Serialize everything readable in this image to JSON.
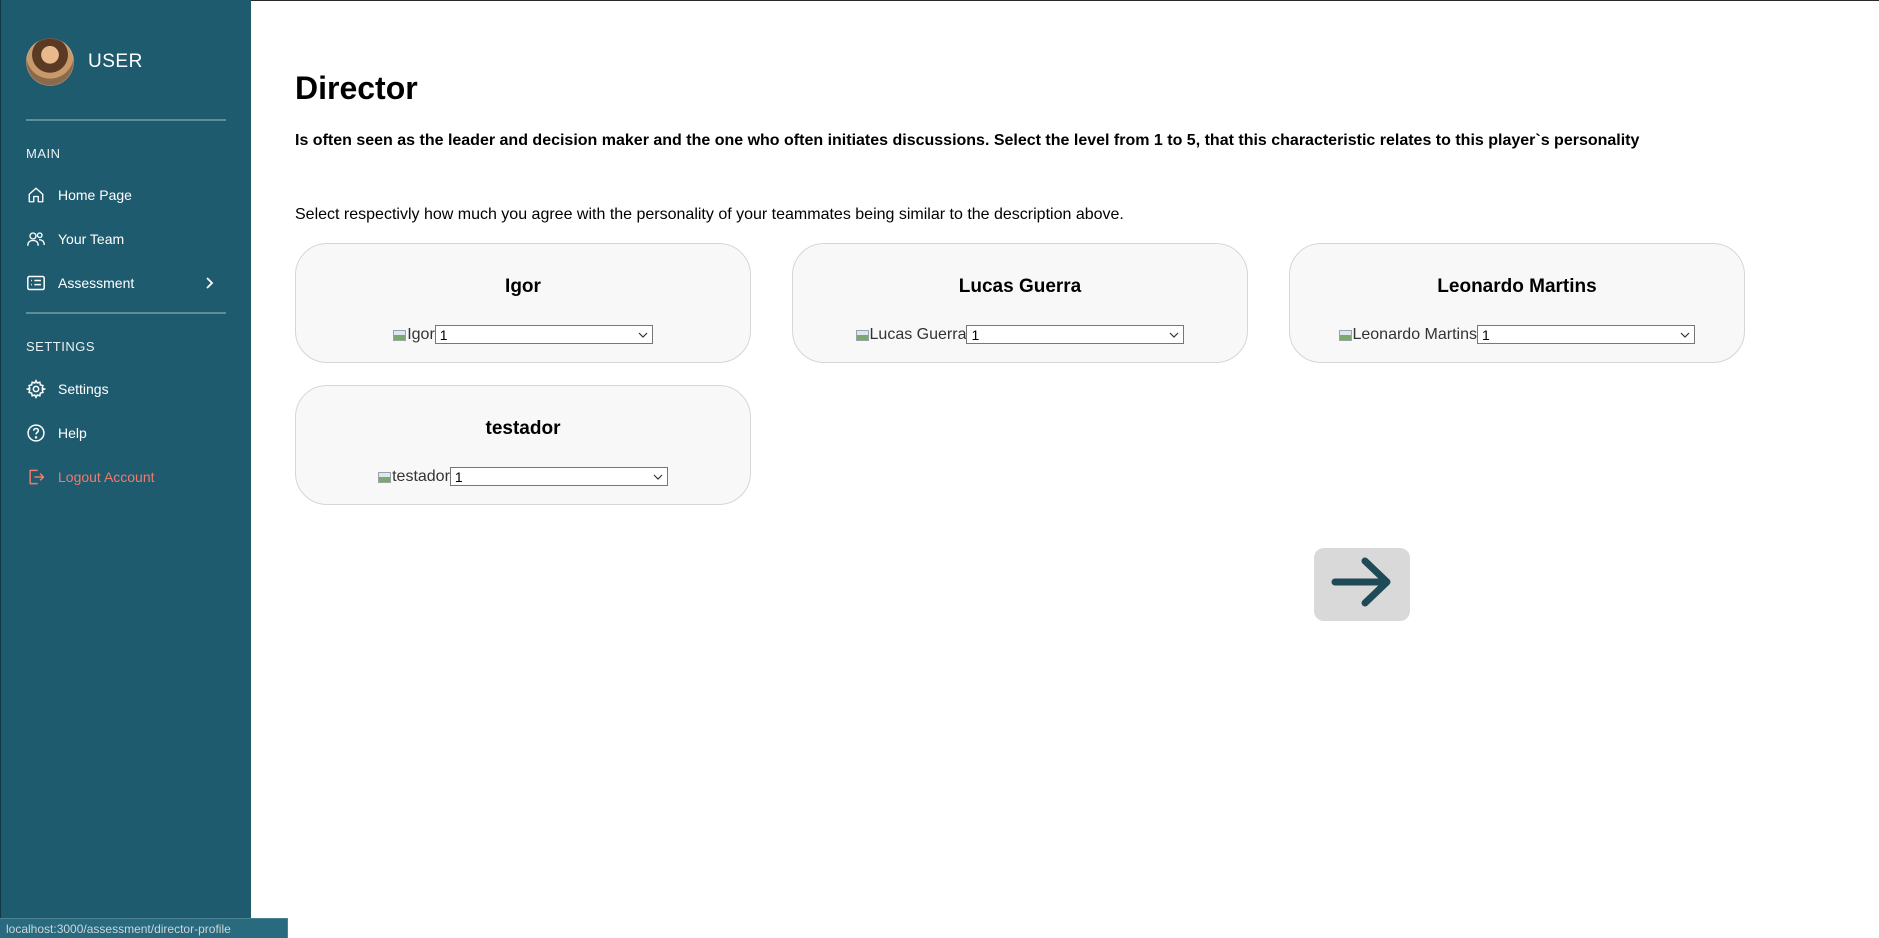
{
  "user": {
    "name": "USER"
  },
  "sidebar": {
    "main_title": "MAIN",
    "settings_title": "SETTINGS",
    "items": [
      {
        "label": "Home Page",
        "icon": "home-icon"
      },
      {
        "label": "Your Team",
        "icon": "users-icon"
      },
      {
        "label": "Assessment",
        "icon": "assessment-icon"
      },
      {
        "label": "Settings",
        "icon": "gear-icon"
      },
      {
        "label": "Help",
        "icon": "help-icon"
      },
      {
        "label": "Logout Account",
        "icon": "logout-icon"
      }
    ],
    "logout_color": "#f07a6b"
  },
  "page": {
    "title": "Director",
    "description": "Is often seen as the leader and decision maker and the one who often initiates discussions. Select the level from 1 to 5, that this characteristic relates to this player`s personality",
    "instruction": "Select respectivly how much you agree with the personality of your teammates being similar to the description above."
  },
  "teammates": [
    {
      "name": "Igor",
      "image_alt": "Igor",
      "level": "1"
    },
    {
      "name": "Lucas Guerra",
      "image_alt": "Lucas Guerra",
      "level": "1"
    },
    {
      "name": "Leonardo Martins",
      "image_alt": "Leonardo Martins",
      "level": "1"
    },
    {
      "name": "testador",
      "image_alt": "testador",
      "level": "1"
    }
  ],
  "status_bar_url": "localhost:3000/assessment/director-profile",
  "colors": {
    "sidebar_bg": "#1f5b6f",
    "next_button_bg": "#d9d9d9",
    "arrow": "#1f4a58"
  }
}
